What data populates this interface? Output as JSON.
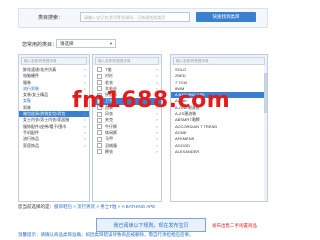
{
  "search": {
    "label": "类目搜索：",
    "placeholder": "请输入宝贝名/货号等关键词，可快速找到类目",
    "button_label": "快速找到类目"
  },
  "common": {
    "label": "您常用的类目：",
    "selected": "请选择"
  },
  "panel1": {
    "search_placeholder": "输入名称/拼音首字母",
    "items": [
      {
        "label": "鲜花速递/花卉仿真",
        "arrow": ">"
      },
      {
        "label": "电脑硬件",
        "arrow": ">"
      },
      {
        "label": "服装",
        "arrow": ">"
      },
      {
        "label": "流行男装",
        "arrow": ">"
      },
      {
        "label": "女装/女士精品",
        "arrow": ">"
      },
      {
        "label": "女鞋",
        "arrow": ">"
      },
      {
        "label": "男装",
        "arrow": ">"
      },
      {
        "label": "箱包皮具/热销女包/男包",
        "arrow": ">"
      },
      {
        "label": "女士内衣/男士内衣/家居服",
        "arrow": ">"
      },
      {
        "label": "服饰配件/皮带/帽子/围巾",
        "arrow": ">"
      },
      {
        "label": "手机配件",
        "arrow": ">"
      },
      {
        "label": "流行饰品",
        "arrow": ">"
      },
      {
        "label": "家居饰品",
        "arrow": ">"
      }
    ]
  },
  "panel2": {
    "search_placeholder": "输入名称/拼音首字母",
    "items": [
      {
        "label": "T恤",
        "arrow": ">"
      },
      {
        "label": "衬衫",
        "arrow": ">"
      },
      {
        "label": "毛衣",
        "arrow": ">"
      },
      {
        "label": "羊毛衫",
        "arrow": ">"
      },
      {
        "label": "针织衫",
        "arrow": ">"
      },
      {
        "label": "卫衣",
        "arrow": ">"
      },
      {
        "label": "西装",
        "arrow": ">"
      },
      {
        "label": "风衣",
        "arrow": ">"
      },
      {
        "label": "夹克",
        "arrow": ">"
      },
      {
        "label": "牛仔裤",
        "arrow": ">"
      },
      {
        "label": "休闲裤",
        "arrow": ">"
      },
      {
        "label": "马甲",
        "arrow": ">"
      },
      {
        "label": "羽绒服",
        "arrow": ">"
      },
      {
        "label": "棉衣",
        "arrow": ">"
      }
    ]
  },
  "panel3": {
    "search_placeholder": "输入名称/拼音首字母",
    "items": [
      {
        "label": "SOLO"
      },
      {
        "label": "2NED"
      },
      {
        "label": "7.7CM"
      },
      {
        "label": "8WM"
      },
      {
        "label": "A BATHING APE"
      },
      {
        "label": "A-Hart"
      },
      {
        "label": "A-ONE潮流装"
      },
      {
        "label": "A-ZS潮流装"
      },
      {
        "label": "ABSMRT潮牌"
      },
      {
        "label": "ACCORDIAN T TREND"
      },
      {
        "label": "ACME"
      },
      {
        "label": "AFKMENS"
      },
      {
        "label": "AGOOD"
      },
      {
        "label": "ALEXANDER"
      }
    ]
  },
  "selected_bar": {
    "label": "您当前选择的是：",
    "path": "服饰鞋包 > 流行男装 > 男士T恤 > A BATHING APE"
  },
  "confirm_button": "我已阅读以下规则，现在发布宝贝",
  "side_link": "发布出售二手闲置商品",
  "footer_note": "温馨提示：请确认商品类目准确，如因类目错误导致商品被删除，需自行承担相应后果。",
  "watermark": "fm1688.com",
  "colors": {
    "accent": "#3a7fd0",
    "link": "#2b6fc2",
    "warning": "#e02020",
    "watermark": "#e41b1b"
  }
}
